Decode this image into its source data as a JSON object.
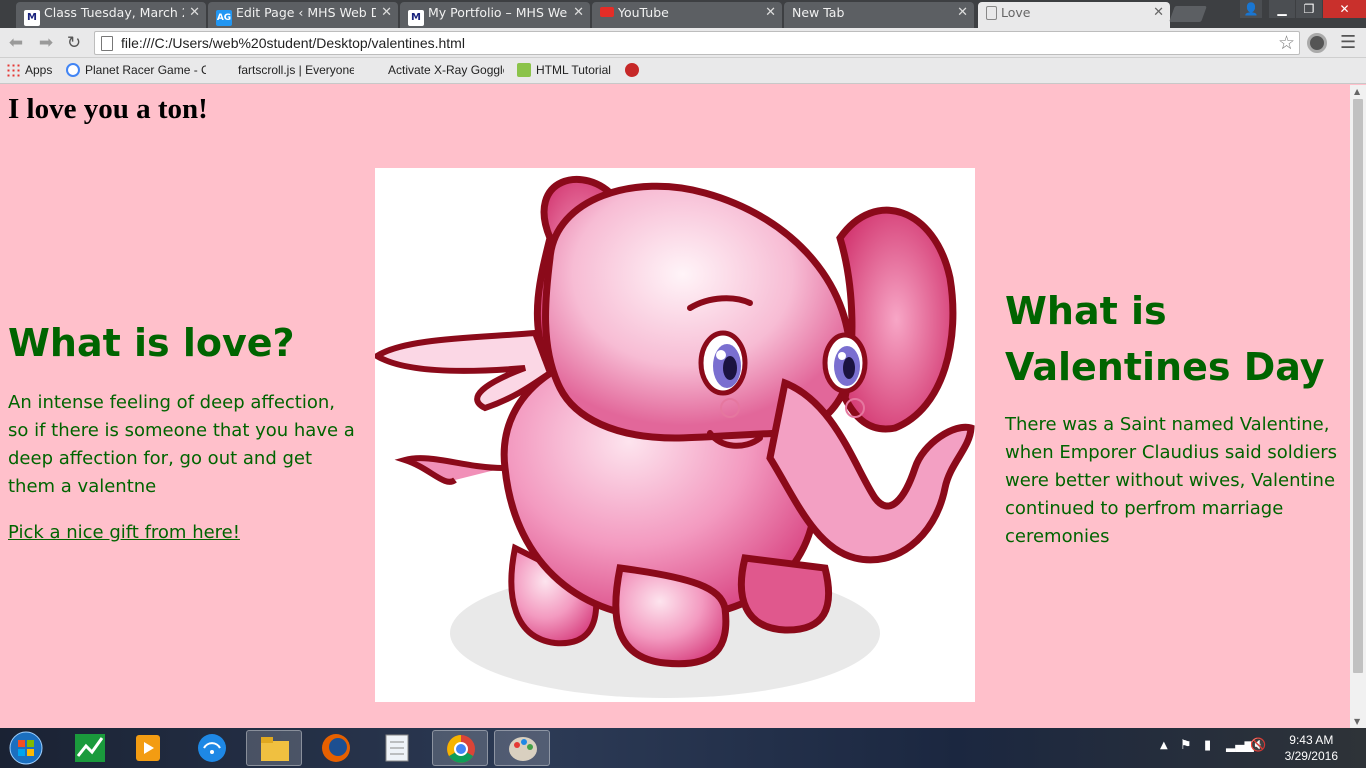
{
  "tabs": [
    {
      "title": "Class Tuesday, March 29, 2",
      "favicon": "M"
    },
    {
      "title": "Edit Page ‹ MHS Web Des",
      "favicon": "AG"
    },
    {
      "title": "My Portfolio – MHS Web I",
      "favicon": "M"
    },
    {
      "title": "YouTube",
      "favicon": "youtube-icon"
    },
    {
      "title": "New Tab",
      "favicon": ""
    },
    {
      "title": "Love",
      "favicon": "page-icon",
      "active": true
    }
  ],
  "toolbar": {
    "url": "file:///C:/Users/web%20student/Desktop/valentines.html"
  },
  "bookmarks": [
    {
      "label": "Apps"
    },
    {
      "label": "Planet Racer Game - C"
    },
    {
      "label": "fartscroll.js | Everyone"
    },
    {
      "label": "Activate X-Ray Goggle"
    },
    {
      "label": "HTML Tutorial"
    }
  ],
  "page": {
    "heading": "I love you a ton!",
    "left": {
      "title": "What is love?",
      "text": "An intense feeling of deep affection, so if there is someone that you have a deep affection for, go out and get them a valentne",
      "link": "Pick a nice gift from here!"
    },
    "right": {
      "title": "What is Valentines Day",
      "text": "There was a Saint named Valentine, when Emporer Claudius said soldiers were better without wives, Valentine continued to perfrom marriage ceremonies"
    }
  },
  "taskbar": {
    "time": "9:43 AM",
    "date": "3/29/2016"
  },
  "colors": {
    "page_bg": "#ffc0cb",
    "heading_green": "#006400"
  }
}
